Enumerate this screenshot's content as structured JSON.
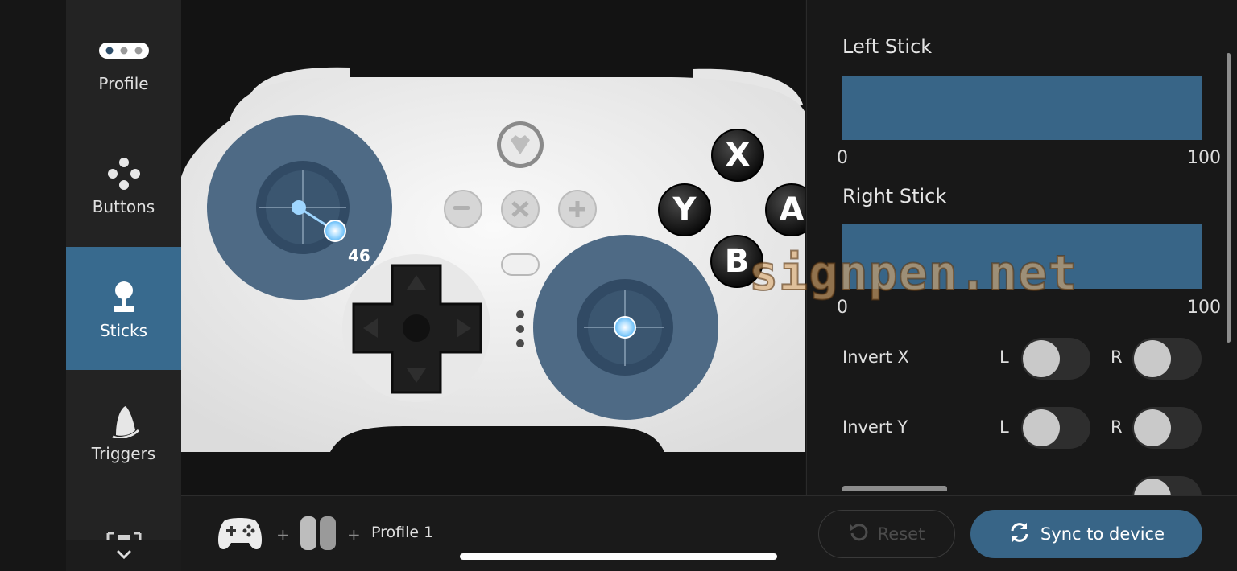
{
  "sidebar": {
    "items": [
      {
        "label": "Profile",
        "icon": "profile-dots-icon"
      },
      {
        "label": "Buttons",
        "icon": "buttons-cluster-icon"
      },
      {
        "label": "Sticks",
        "icon": "joystick-icon",
        "active": true
      },
      {
        "label": "Triggers",
        "icon": "trigger-icon"
      }
    ],
    "more_icon": "chevron-down-icon"
  },
  "controller": {
    "left_stick_value": "46",
    "face_buttons": {
      "x": "X",
      "y": "Y",
      "a": "A",
      "b": "B"
    }
  },
  "panel": {
    "left_stick": {
      "title": "Left Stick",
      "min": "0",
      "max": "100"
    },
    "right_stick": {
      "title": "Right Stick",
      "min": "0",
      "max": "100"
    },
    "invert_x": {
      "label": "Invert X",
      "left": "L",
      "right": "R",
      "left_on": false,
      "right_on": false
    },
    "invert_y": {
      "label": "Invert Y",
      "left": "L",
      "right": "R",
      "left_on": false,
      "right_on": false
    }
  },
  "bottom": {
    "plus": "+",
    "profile_label": "Profile 1",
    "reset_label": "Reset",
    "sync_label": "Sync to device"
  },
  "watermark": "signpen.net",
  "colors": {
    "accent": "#386a8e",
    "bar": "#386587",
    "stick_zone": "#4e6a85",
    "stick_dot": "#8fd0ff"
  }
}
